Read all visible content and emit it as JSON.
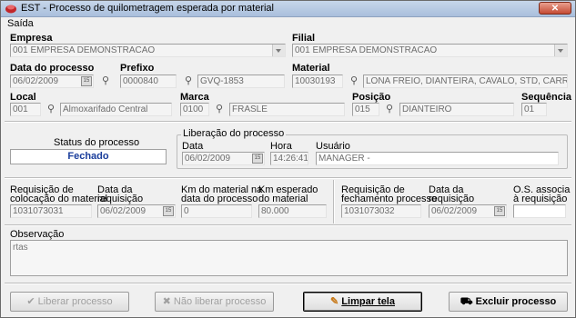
{
  "window": {
    "title": "EST - Processo de quilometragem esperada por material",
    "close_label": "✕"
  },
  "menu": {
    "items": [
      "Saída"
    ]
  },
  "empresa": {
    "label": "Empresa",
    "value": "001 EMPRESA DEMONSTRACAO"
  },
  "filial": {
    "label": "Filial",
    "value": "001 EMPRESA DEMONSTRACAO"
  },
  "data_processo": {
    "label": "Data do processo",
    "value": "06/02/2009"
  },
  "prefixo": {
    "label": "Prefixo",
    "code": "0000840",
    "desc": "GVQ-1853"
  },
  "material": {
    "label": "Material",
    "code": "10030193",
    "desc": "LONA FREIO, DIANTEIRA, CAVALO, STD, CARRETA"
  },
  "local": {
    "label": "Local",
    "code": "001",
    "desc": "Almoxarifado Central"
  },
  "marca": {
    "label": "Marca",
    "code": "0100",
    "desc": "FRASLE"
  },
  "posicao": {
    "label": "Posição",
    "code": "015",
    "desc": "DIANTEIRO"
  },
  "sequencia": {
    "label": "Sequência",
    "value": "01"
  },
  "status": {
    "label": "Status do processo",
    "value": "Fechado",
    "color": "#1a3d9b"
  },
  "liberacao": {
    "title": "Liberação do processo",
    "data_label": "Data",
    "data_value": "06/02/2009",
    "hora_label": "Hora",
    "hora_value": "14:26:41",
    "usuario_label": "Usuário",
    "usuario_value": "MANAGER -"
  },
  "colocacao": {
    "req_label_1": "Requisição de",
    "req_label_2": "colocação do material",
    "req_value": "1031073031",
    "data_label_1": "Data da",
    "data_label_2": "requisição",
    "data_value": "06/02/2009",
    "km_label_1": "Km do material na",
    "km_label_2": "data do processo",
    "km_value": "0",
    "kmesp_label_1": "Km esperado",
    "kmesp_label_2": "do material",
    "kmesp_value": "80.000"
  },
  "fechamento": {
    "req_label_1": "Requisição de",
    "req_label_2": "fechamento processo",
    "req_value": "1031073032",
    "data_label_1": "Data da",
    "data_label_2": "requisição",
    "data_value": "06/02/2009",
    "os_label_1": "O.S. associa",
    "os_label_2": "à requisição",
    "os_value": ""
  },
  "observacao": {
    "label": "Observação",
    "value": "rtas"
  },
  "buttons": {
    "liberar": "Liberar processo",
    "nao_liberar": "Não liberar processo",
    "limpar": "Limpar tela",
    "excluir": "Excluir processo"
  }
}
